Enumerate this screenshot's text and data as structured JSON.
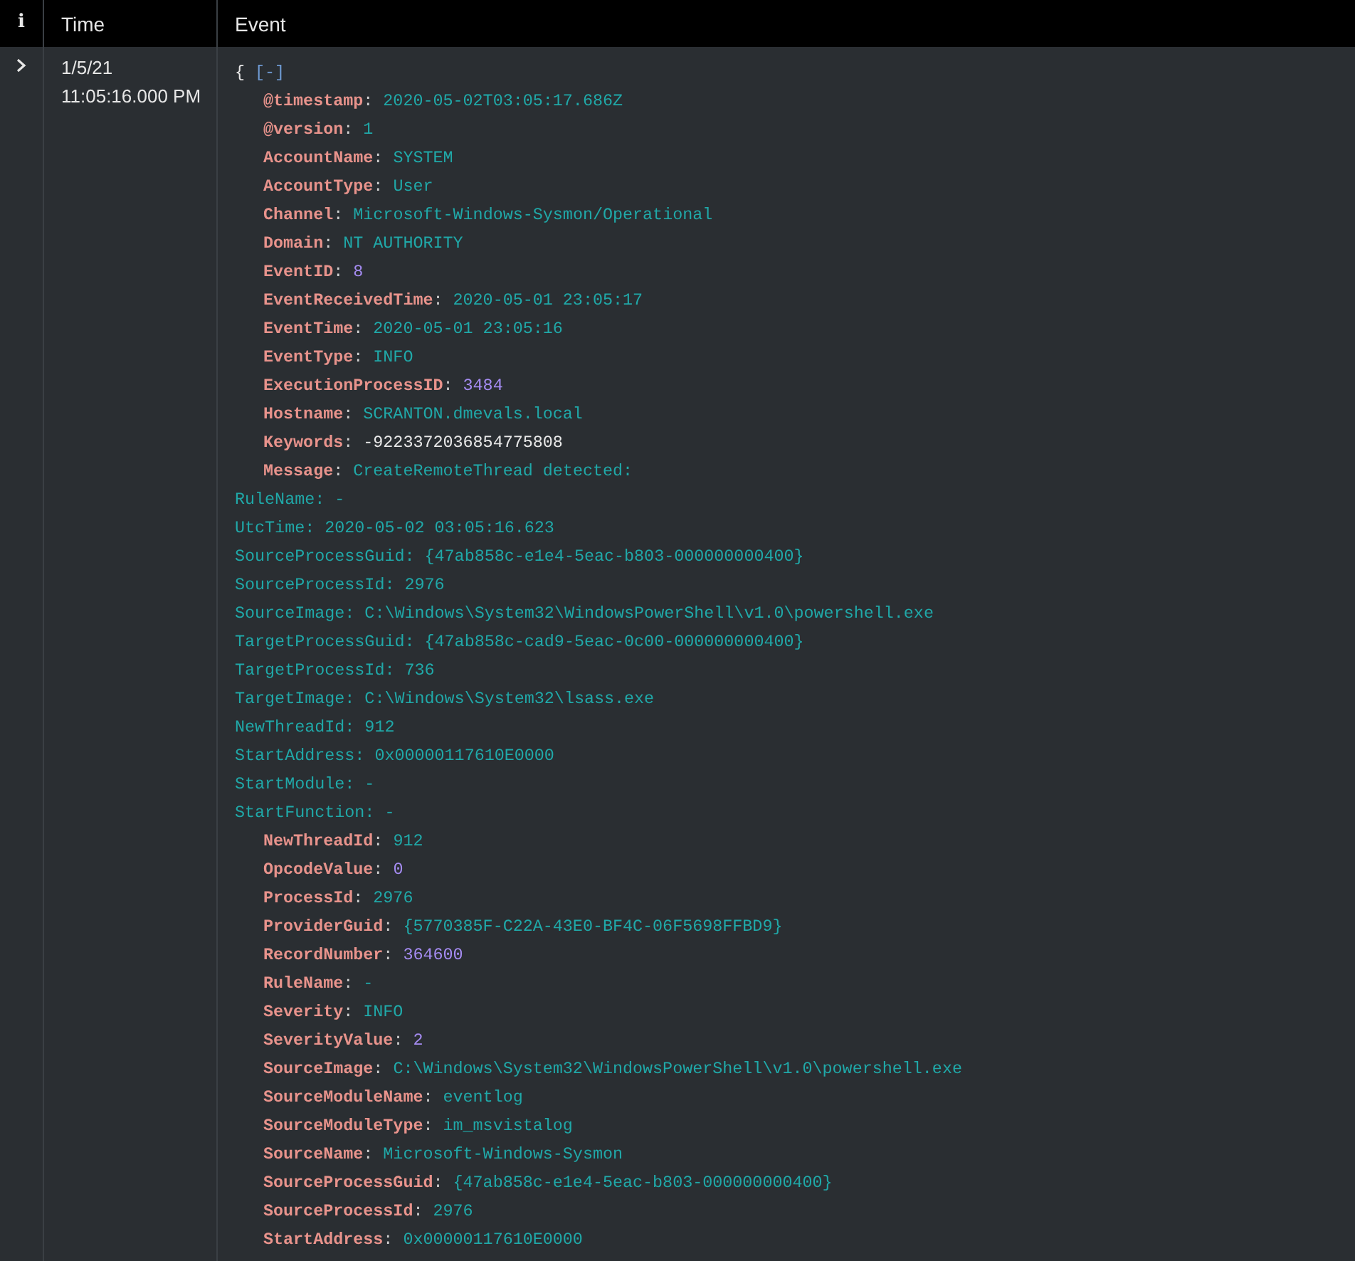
{
  "table": {
    "columns": [
      {
        "label": "i"
      },
      {
        "label": "Time"
      },
      {
        "label": "Event"
      }
    ],
    "rows": [
      {
        "expanded": true,
        "time_date": "1/5/21",
        "time_clock": "11:05:16.000 PM",
        "event": {
          "open_brace": "{",
          "collapse_link": "[-]",
          "lines": [
            {
              "kind": "field",
              "key": "**@timestamp**:",
              "value": {
                "kind": "string",
                "text": "2020-05-02T03:05:17.686Z"
              }
            },
            {
              "kind": "field",
              "key": "**@version**:",
              "value": {
                "kind": "string",
                "text": "1"
              }
            },
            {
              "kind": "field",
              "key": "**AccountName**:",
              "value": {
                "kind": "string",
                "text": "SYSTEM"
              }
            },
            {
              "kind": "field",
              "key": "**AccountType**:",
              "value": {
                "kind": "string",
                "text": "User"
              }
            },
            {
              "kind": "field",
              "key": "**Channel**:",
              "value": {
                "kind": "string",
                "text": "Microsoft-Windows-Sysmon/Operational"
              }
            },
            {
              "kind": "field",
              "key": "**Domain**:",
              "value": {
                "kind": "string",
                "text": "NT AUTHORITY"
              }
            },
            {
              "kind": "field",
              "key": "**EventID**:",
              "value": {
                "kind": "number",
                "text": "8"
              }
            },
            {
              "kind": "field",
              "key": "**EventReceivedTime**:",
              "value": {
                "kind": "string",
                "text": "2020-05-01 23:05:17"
              }
            },
            {
              "kind": "field",
              "key": "**EventTime**:",
              "value": {
                "kind": "string",
                "text": "2020-05-01 23:05:16"
              }
            },
            {
              "kind": "field",
              "key": "**EventType**:",
              "value": {
                "kind": "string",
                "text": "INFO"
              }
            },
            {
              "kind": "field",
              "key": "**ExecutionProcessID**:",
              "value": {
                "kind": "number",
                "text": "3484"
              }
            },
            {
              "kind": "field",
              "key": "**Hostname**:",
              "value": {
                "kind": "string",
                "text": "SCRANTON.dmevals.local"
              }
            },
            {
              "kind": "field",
              "key": "**Keywords**:",
              "value": {
                "kind": "plain",
                "text": "-9223372036854775808"
              }
            },
            {
              "kind": "field",
              "key": "**Message**:",
              "value": {
                "kind": "string",
                "text": "CreateRemoteThread detected:"
              }
            },
            {
              "kind": "continuation",
              "text": "RuleName: -"
            },
            {
              "kind": "continuation",
              "text": "UtcTime: 2020-05-02 03:05:16.623"
            },
            {
              "kind": "continuation",
              "text": "SourceProcessGuid: {47ab858c-e1e4-5eac-b803-000000000400}"
            },
            {
              "kind": "continuation",
              "text": "SourceProcessId: 2976"
            },
            {
              "kind": "continuation",
              "text": "SourceImage: C:\\Windows\\System32\\WindowsPowerShell\\v1.0\\powershell.exe"
            },
            {
              "kind": "continuation",
              "text": "TargetProcessGuid: {47ab858c-cad9-5eac-0c00-000000000400}"
            },
            {
              "kind": "continuation",
              "text": "TargetProcessId: 736"
            },
            {
              "kind": "continuation",
              "text": "TargetImage: C:\\Windows\\System32\\lsass.exe"
            },
            {
              "kind": "continuation",
              "text": "NewThreadId: 912"
            },
            {
              "kind": "continuation",
              "text": "StartAddress: 0x00000117610E0000"
            },
            {
              "kind": "continuation",
              "text": "StartModule: -"
            },
            {
              "kind": "continuation",
              "text": "StartFunction: -"
            },
            {
              "kind": "field",
              "key": "**NewThreadId**:",
              "value": {
                "kind": "string",
                "text": "912"
              }
            },
            {
              "kind": "field",
              "key": "**OpcodeValue**:",
              "value": {
                "kind": "number",
                "text": "0"
              }
            },
            {
              "kind": "field",
              "key": "**ProcessId**:",
              "value": {
                "kind": "string",
                "text": "2976"
              }
            },
            {
              "kind": "field",
              "key": "**ProviderGuid**:",
              "value": {
                "kind": "string",
                "text": "{5770385F-C22A-43E0-BF4C-06F5698FFBD9}"
              }
            },
            {
              "kind": "field",
              "key": "**RecordNumber**:",
              "value": {
                "kind": "number",
                "text": "364600"
              }
            },
            {
              "kind": "field",
              "key": "**RuleName**:",
              "value": {
                "kind": "string",
                "text": "-"
              }
            },
            {
              "kind": "field",
              "key": "**Severity**:",
              "value": {
                "kind": "string",
                "text": "INFO"
              }
            },
            {
              "kind": "field",
              "key": "**SeverityValue**:",
              "value": {
                "kind": "number",
                "text": "2"
              }
            },
            {
              "kind": "field",
              "key": "**SourceImage**:",
              "value": {
                "kind": "string",
                "text": "C:\\Windows\\System32\\WindowsPowerShell\\v1.0\\powershell.exe"
              }
            },
            {
              "kind": "field",
              "key": "**SourceModuleName**:",
              "value": {
                "kind": "string",
                "text": "eventlog"
              }
            },
            {
              "kind": "field",
              "key": "**SourceModuleType**:",
              "value": {
                "kind": "string",
                "text": "im_msvistalog"
              }
            },
            {
              "kind": "field",
              "key": "**SourceName**:",
              "value": {
                "kind": "string",
                "text": "Microsoft-Windows-Sysmon"
              }
            },
            {
              "kind": "field",
              "key": "**SourceProcessGuid**:",
              "value": {
                "kind": "string",
                "text": "{47ab858c-e1e4-5eac-b803-000000000400}"
              }
            },
            {
              "kind": "field",
              "key": "**SourceProcessId**:",
              "value": {
                "kind": "string",
                "text": "2976"
              }
            },
            {
              "kind": "field",
              "key": "**StartAddress**:",
              "value": {
                "kind": "string",
                "text": "0x00000117610E0000"
              }
            }
          ]
        }
      }
    ]
  }
}
